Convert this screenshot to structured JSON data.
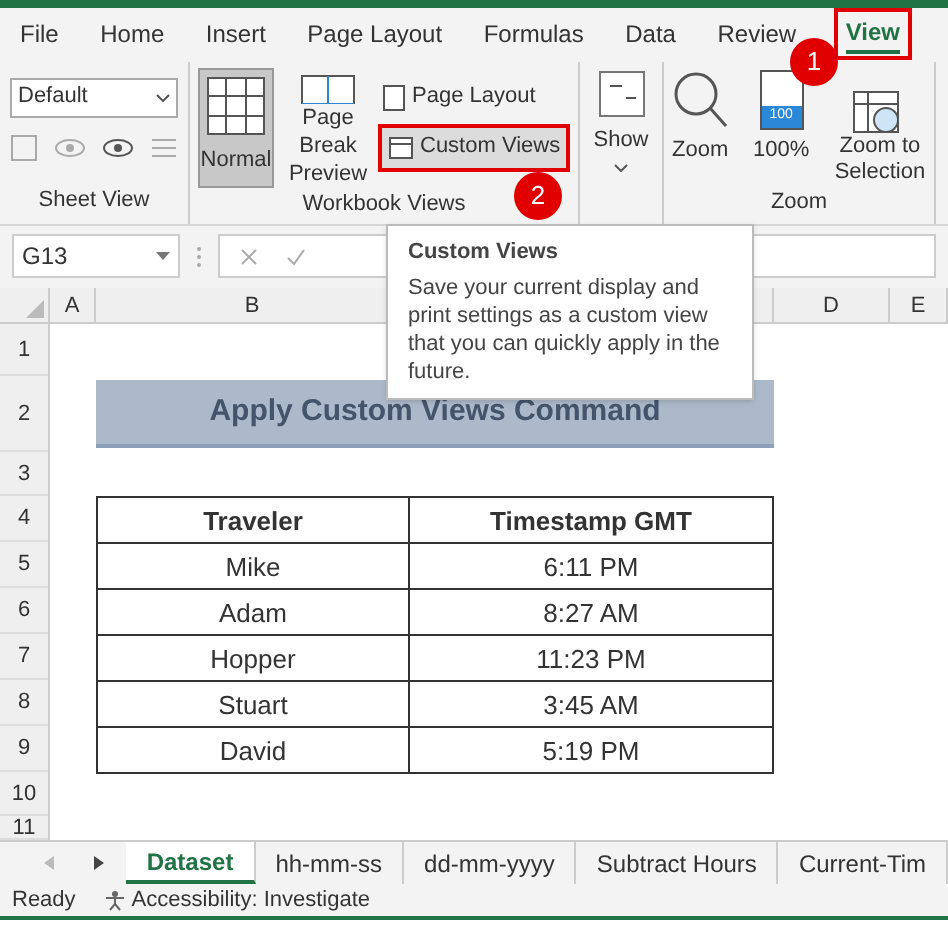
{
  "menu_tabs": [
    {
      "label": "File",
      "selected": false,
      "highlighted": false
    },
    {
      "label": "Home",
      "selected": false,
      "highlighted": false
    },
    {
      "label": "Insert",
      "selected": false,
      "highlighted": false
    },
    {
      "label": "Page Layout",
      "selected": false,
      "highlighted": false
    },
    {
      "label": "Formulas",
      "selected": false,
      "highlighted": false
    },
    {
      "label": "Data",
      "selected": false,
      "highlighted": false
    },
    {
      "label": "Review",
      "selected": false,
      "highlighted": false
    },
    {
      "label": "View",
      "selected": true,
      "highlighted": true
    }
  ],
  "ribbon": {
    "sheet_view": {
      "dropdown": "Default",
      "label": "Sheet View"
    },
    "workbook_views": {
      "label": "Workbook Views",
      "normal": {
        "label": "Normal",
        "selected": true
      },
      "page_break": "Page Break Preview",
      "page_layout": "Page Layout",
      "custom_views": "Custom Views"
    },
    "show": "Show",
    "zoom": {
      "label": "Zoom",
      "zoom_button": "Zoom",
      "percent_button": "100%",
      "percent_icon_text": "100",
      "selection_button": "Zoom to Selection"
    }
  },
  "callouts": [
    "1",
    "2"
  ],
  "formula_bar": {
    "name_box": "G13"
  },
  "tooltip": {
    "title": "Custom Views",
    "body": "Save your current display and print settings as a custom view that you can quickly apply in the future."
  },
  "columns": [
    "A",
    "B",
    "D",
    "E"
  ],
  "rows": [
    "1",
    "2",
    "3",
    "4",
    "5",
    "6",
    "7",
    "8",
    "9",
    "10",
    "11"
  ],
  "title_cell": "Apply Custom Views Command",
  "table": {
    "columns": [
      "Traveler",
      "Timestamp GMT"
    ],
    "rows": [
      [
        "Mike",
        "6:11 PM"
      ],
      [
        "Adam",
        "8:27 AM"
      ],
      [
        "Hopper",
        "11:23 PM"
      ],
      [
        "Stuart",
        "3:45 AM"
      ],
      [
        "David",
        "5:19 PM"
      ]
    ]
  },
  "sheet_tabs": [
    {
      "label": "Dataset",
      "selected": true
    },
    {
      "label": "hh-mm-ss",
      "selected": false
    },
    {
      "label": "dd-mm-yyyy",
      "selected": false
    },
    {
      "label": "Subtract Hours",
      "selected": false
    },
    {
      "label": "Current-Tim",
      "selected": false
    }
  ],
  "status_bar": {
    "ready": "Ready",
    "accessibility": "Accessibility: Investigate"
  }
}
